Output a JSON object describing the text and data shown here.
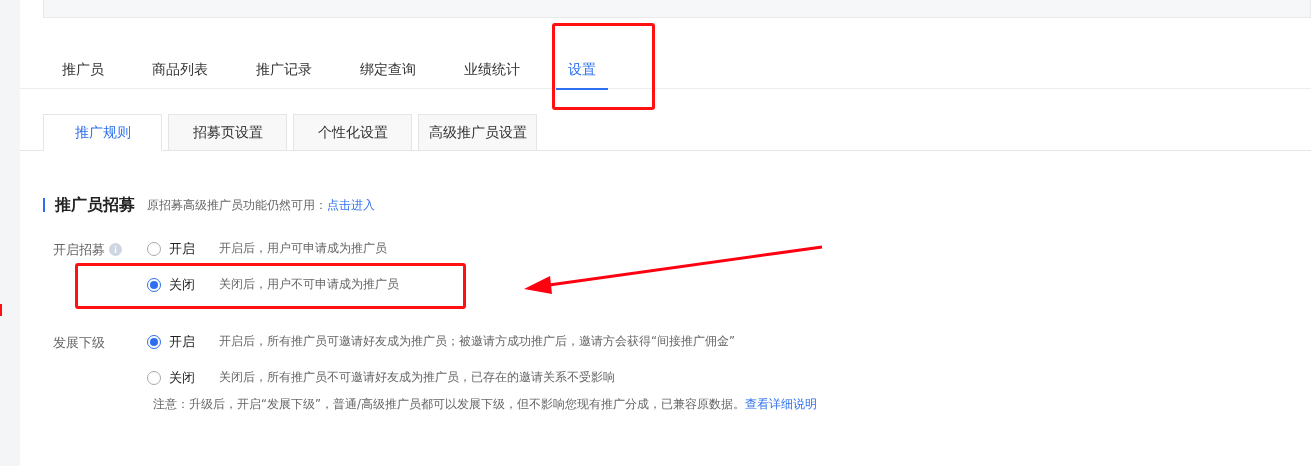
{
  "tabs": [
    {
      "label": "推广员",
      "selected": false
    },
    {
      "label": "商品列表",
      "selected": false
    },
    {
      "label": "推广记录",
      "selected": false
    },
    {
      "label": "绑定查询",
      "selected": false
    },
    {
      "label": "业绩统计",
      "selected": false
    },
    {
      "label": "设置",
      "selected": true
    }
  ],
  "sub_tabs": [
    {
      "label": "推广规则",
      "selected": true
    },
    {
      "label": "招募页设置",
      "selected": false
    },
    {
      "label": "个性化设置",
      "selected": false
    },
    {
      "label": "高级推广员设置",
      "selected": false
    }
  ],
  "section": {
    "title": "推广员招募",
    "hint": "原招募高级推广员功能仍然可用：",
    "link": "点击进入"
  },
  "settings": [
    {
      "label": "开启招募",
      "info": true,
      "options": [
        {
          "label": "开启",
          "description": "开启后，用户可申请成为推广员",
          "selected": false
        },
        {
          "label": "关闭",
          "description": "关闭后，用户不可申请成为推广员",
          "selected": true
        }
      ]
    },
    {
      "label": "发展下级",
      "info": false,
      "options": [
        {
          "label": "开启",
          "description": "开启后，所有推广员可邀请好友成为推广员；被邀请方成功推广后，邀请方会获得“间接推广佣金”",
          "selected": true
        },
        {
          "label": "关闭",
          "description": "关闭后，所有推广员不可邀请好友成为推广员，已存在的邀请关系不受影响",
          "selected": false
        }
      ],
      "note": "注意：升级后，开启“发展下级”，普通/高级推广员都可以发展下级，但不影响您现有推广分成，已兼容原数据。",
      "note_link": "查看详细说明"
    }
  ]
}
